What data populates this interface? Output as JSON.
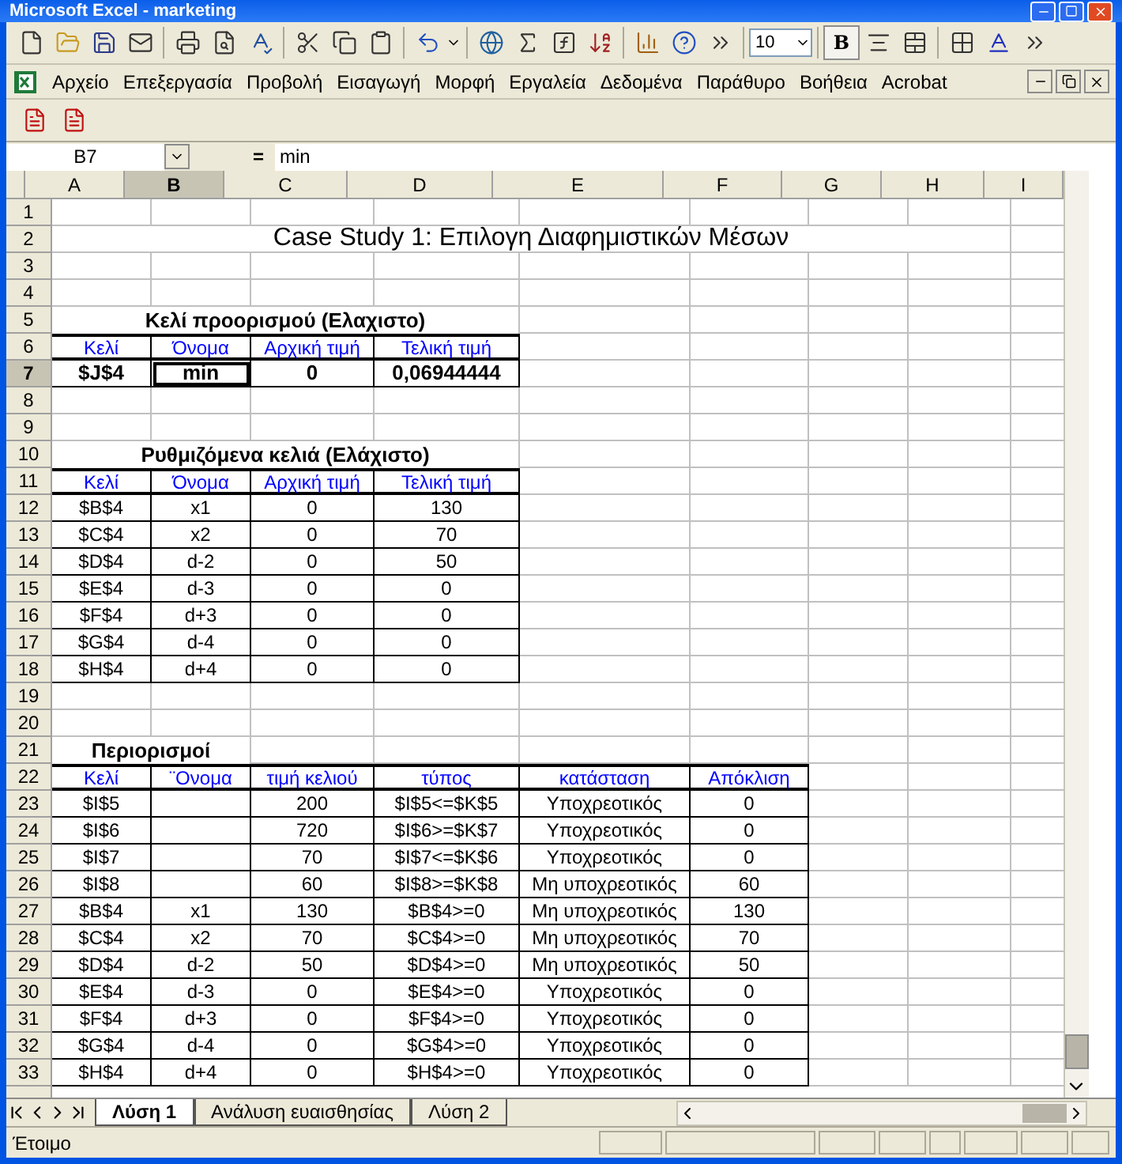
{
  "window": {
    "title": "Microsoft Excel - marketing"
  },
  "toolbar": {
    "font_size": "10",
    "bold": "B"
  },
  "menu": [
    "Αρχείο",
    "Επεξεργασία",
    "Προβολή",
    "Εισαγωγή",
    "Μορφή",
    "Εργαλεία",
    "Δεδομένα",
    "Παράθυρο",
    "Βοήθεια",
    "Acrobat"
  ],
  "formula_bar": {
    "name_box": "B7",
    "equals": "=",
    "content": "min"
  },
  "columns": [
    {
      "label": "A",
      "selected": false
    },
    {
      "label": "B",
      "selected": true
    },
    {
      "label": "C",
      "selected": false
    },
    {
      "label": "D",
      "selected": false
    },
    {
      "label": "E",
      "selected": false
    },
    {
      "label": "F",
      "selected": false
    },
    {
      "label": "G",
      "selected": false
    },
    {
      "label": "H",
      "selected": false
    },
    {
      "label": "I",
      "selected": false
    }
  ],
  "row_headers": [
    {
      "label": "1",
      "selected": false
    },
    {
      "label": "2",
      "selected": false
    },
    {
      "label": "3",
      "selected": false
    },
    {
      "label": "4",
      "selected": false
    },
    {
      "label": "5",
      "selected": false
    },
    {
      "label": "6",
      "selected": false
    },
    {
      "label": "7",
      "selected": true
    },
    {
      "label": "8",
      "selected": false
    },
    {
      "label": "9",
      "selected": false
    },
    {
      "label": "10",
      "selected": false
    },
    {
      "label": "11",
      "selected": false
    },
    {
      "label": "12",
      "selected": false
    },
    {
      "label": "13",
      "selected": false
    },
    {
      "label": "14",
      "selected": false
    },
    {
      "label": "15",
      "selected": false
    },
    {
      "label": "16",
      "selected": false
    },
    {
      "label": "17",
      "selected": false
    },
    {
      "label": "18",
      "selected": false
    },
    {
      "label": "19",
      "selected": false
    },
    {
      "label": "20",
      "selected": false
    },
    {
      "label": "21",
      "selected": false
    },
    {
      "label": "22",
      "selected": false
    },
    {
      "label": "23",
      "selected": false
    },
    {
      "label": "24",
      "selected": false
    },
    {
      "label": "25",
      "selected": false
    },
    {
      "label": "26",
      "selected": false
    },
    {
      "label": "27",
      "selected": false
    },
    {
      "label": "28",
      "selected": false
    },
    {
      "label": "29",
      "selected": false
    },
    {
      "label": "30",
      "selected": false
    },
    {
      "label": "31",
      "selected": false
    },
    {
      "label": "32",
      "selected": false
    },
    {
      "label": "33",
      "selected": false
    }
  ],
  "sheet_title": "Case Study 1: Επιλογη Διαφημιστικών Μέσων",
  "target": {
    "heading": "Κελί προορισμού (Ελαχιστο)",
    "columns": [
      "Κελί",
      "Όνομα",
      "Αρχική τιμή",
      "Τελική τιμή"
    ],
    "rows": [
      {
        "cell": "$J$4",
        "name": "min",
        "initial": "0",
        "final": "0,06944444"
      }
    ]
  },
  "adjustable": {
    "heading": "Ρυθμιζόμενα κελιά (Ελάχιστο)",
    "columns": [
      "Κελί",
      "Όνομα",
      "Αρχική τιμή",
      "Τελική τιμή"
    ],
    "rows": [
      {
        "cell": "$B$4",
        "name": "x1",
        "initial": "0",
        "final": "130"
      },
      {
        "cell": "$C$4",
        "name": "x2",
        "initial": "0",
        "final": "70"
      },
      {
        "cell": "$D$4",
        "name": "d-2",
        "initial": "0",
        "final": "50"
      },
      {
        "cell": "$E$4",
        "name": "d-3",
        "initial": "0",
        "final": "0"
      },
      {
        "cell": "$F$4",
        "name": "d+3",
        "initial": "0",
        "final": "0"
      },
      {
        "cell": "$G$4",
        "name": "d-4",
        "initial": "0",
        "final": "0"
      },
      {
        "cell": "$H$4",
        "name": "d+4",
        "initial": "0",
        "final": "0"
      }
    ]
  },
  "constraints": {
    "heading": "Περιορισμοί",
    "columns": [
      "Κελί",
      "¨Ονομα",
      "τιμή κελιού",
      "τύπος",
      "κατάσταση",
      "Απόκλιση"
    ],
    "rows": [
      {
        "cell": "$I$5",
        "value": "200",
        "type": "$I$5<=$K$5",
        "status": "Υποχρεοτικός",
        "slack": "0"
      },
      {
        "cell": "$I$6",
        "value": "720",
        "type": "$I$6>=$K$7",
        "status": "Υποχρεοτικός",
        "slack": "0"
      },
      {
        "cell": "$I$7",
        "value": "70",
        "type": "$I$7<=$K$6",
        "status": "Υποχρεοτικός",
        "slack": "0"
      },
      {
        "cell": "$I$8",
        "value": "60",
        "type": "$I$8>=$K$8",
        "status": "Μη υποχρεοτικός",
        "slack": "60"
      },
      {
        "cell": "$B$4",
        "name": "x1",
        "value": "130",
        "type": "$B$4>=0",
        "status": "Μη υποχρεοτικός",
        "slack": "130"
      },
      {
        "cell": "$C$4",
        "name": "x2",
        "value": "70",
        "type": "$C$4>=0",
        "status": "Μη υποχρεοτικός",
        "slack": "70"
      },
      {
        "cell": "$D$4",
        "name": "d-2",
        "value": "50",
        "type": "$D$4>=0",
        "status": "Μη υποχρεοτικός",
        "slack": "50"
      },
      {
        "cell": "$E$4",
        "name": "d-3",
        "value": "0",
        "type": "$E$4>=0",
        "status": "Υποχρεοτικός",
        "slack": "0"
      },
      {
        "cell": "$F$4",
        "name": "d+3",
        "value": "0",
        "type": "$F$4>=0",
        "status": "Υποχρεοτικός",
        "slack": "0"
      },
      {
        "cell": "$G$4",
        "name": "d-4",
        "value": "0",
        "type": "$G$4>=0",
        "status": "Υποχρεοτικός",
        "slack": "0"
      },
      {
        "cell": "$H$4",
        "name": "d+4",
        "value": "0",
        "type": "$H$4>=0",
        "status": "Υποχρεοτικός",
        "slack": "0"
      }
    ]
  },
  "sheet_tabs": [
    {
      "label": "Λύση 1",
      "selected": true
    },
    {
      "label": "Ανάλυση ευαισθησίας",
      "selected": false
    },
    {
      "label": "Λύση 2",
      "selected": false
    }
  ],
  "status_bar": {
    "text": "Έτοιμο"
  }
}
